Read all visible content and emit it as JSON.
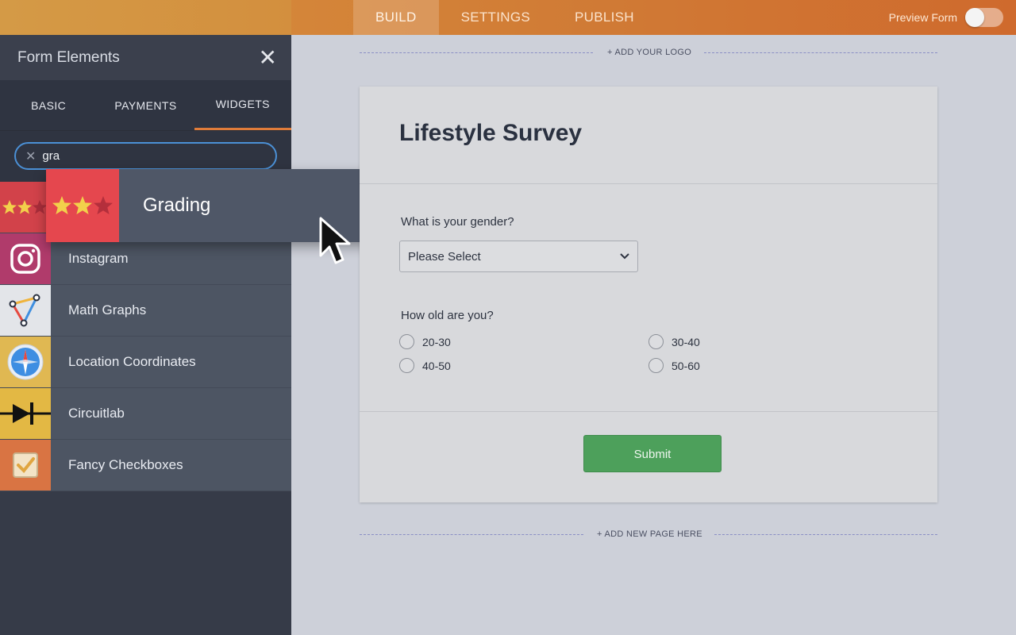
{
  "topbar": {
    "nav": [
      "BUILD",
      "SETTINGS",
      "PUBLISH"
    ],
    "active_tab": "BUILD",
    "preview_label": "Preview Form",
    "preview_on": false
  },
  "sidebar": {
    "title": "Form Elements",
    "tabs": [
      "BASIC",
      "PAYMENTS",
      "WIDGETS"
    ],
    "active_tab": "WIDGETS",
    "search_value": "gra",
    "items": [
      {
        "label": "Instagram",
        "icon": "instagram-icon",
        "color": "#b03b6b"
      },
      {
        "label": "Math Graphs",
        "icon": "graph-icon",
        "color": "#e3e5e9"
      },
      {
        "label": "Location Coordinates",
        "icon": "compass-icon",
        "color": "#e0b852"
      },
      {
        "label": "Circuitlab",
        "icon": "diode-icon",
        "color": "#e3b844"
      },
      {
        "label": "Fancy Checkboxes",
        "icon": "checkbox-icon",
        "color": "#d97443"
      }
    ],
    "dragged_item": {
      "label": "Grading",
      "icon": "stars-icon",
      "color": "#e5474e"
    }
  },
  "canvas": {
    "add_logo": "+ ADD YOUR LOGO",
    "add_page": "+ ADD NEW PAGE HERE"
  },
  "form": {
    "title": "Lifestyle Survey",
    "q1_label": "What is your gender?",
    "q1_value": "Please Select",
    "q2_label": "How old are you?",
    "q2_options": [
      "20-30",
      "30-40",
      "40-50",
      "50-60"
    ],
    "submit_label": "Submit"
  },
  "colors": {
    "accent": "#e07c3a",
    "submit": "#4da05b",
    "search_border": "#4b90d6"
  }
}
